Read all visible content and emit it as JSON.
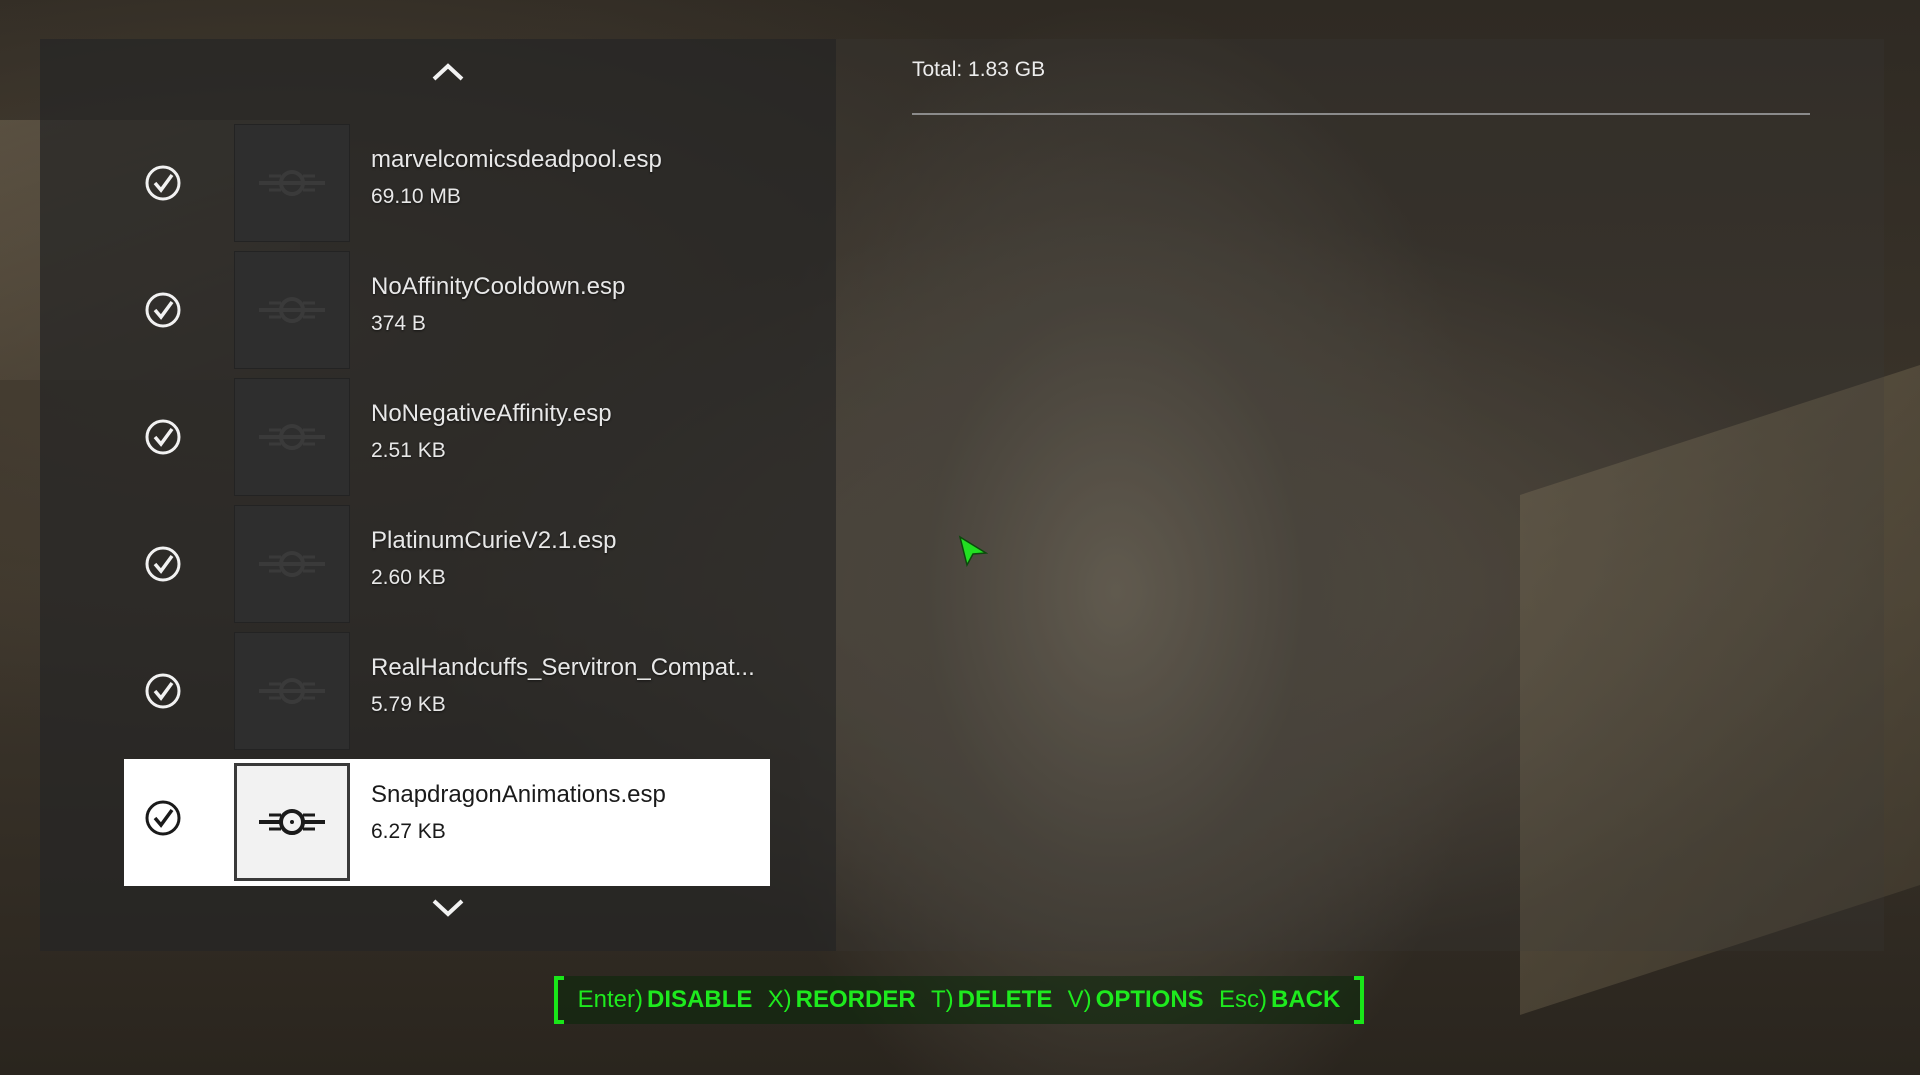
{
  "header": {
    "total": "Total: 1.83 GB"
  },
  "mods": [
    {
      "name": "marvelcomicsdeadpool.esp",
      "size": "69.10 MB",
      "enabled": true,
      "selected": false
    },
    {
      "name": "NoAffinityCooldown.esp",
      "size": "374 B",
      "enabled": true,
      "selected": false
    },
    {
      "name": "NoNegativeAffinity.esp",
      "size": "2.51 KB",
      "enabled": true,
      "selected": false
    },
    {
      "name": "PlatinumCurieV2.1.esp",
      "size": "2.60 KB",
      "enabled": true,
      "selected": false
    },
    {
      "name": "RealHandcuffs_Servitron_Compat...",
      "size": "5.79 KB",
      "enabled": true,
      "selected": false
    },
    {
      "name": "SnapdragonAnimations.esp",
      "size": "6.27 KB",
      "enabled": true,
      "selected": true
    }
  ],
  "icons": {
    "scroll_up": "chevron-up-icon",
    "scroll_down": "chevron-down-icon",
    "checkmark": "checkmark-circle-icon",
    "thumbnail": "vault-tec-placeholder-icon"
  },
  "buttons": [
    {
      "key": "Enter)",
      "action": "DISABLE"
    },
    {
      "key": "X)",
      "action": "REORDER"
    },
    {
      "key": "T)",
      "action": "DELETE"
    },
    {
      "key": "V)",
      "action": "OPTIONS"
    },
    {
      "key": "Esc)",
      "action": "BACK"
    }
  ],
  "colors": {
    "accent": "#1eea1e",
    "selected_bg": "#ffffff"
  }
}
